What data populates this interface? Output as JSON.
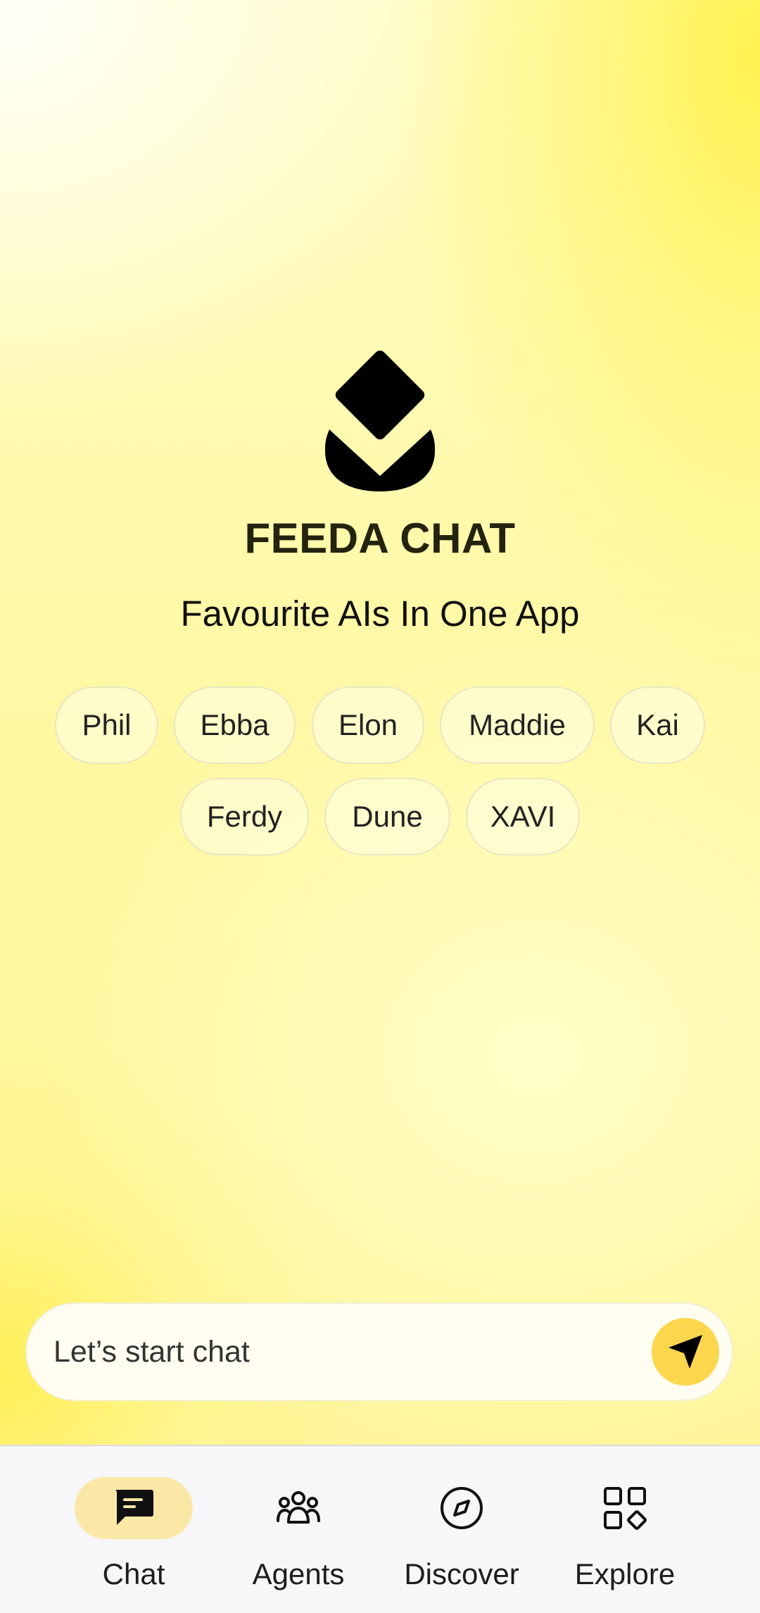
{
  "app": {
    "title": "FEEDA CHAT",
    "subtitle": "Favourite AIs In One App",
    "logo_icon": "feeda-logo-icon"
  },
  "agents": [
    "Phil",
    "Ebba",
    "Elon",
    "Maddie",
    "Kai",
    "Ferdy",
    "Dune",
    "XAVI"
  ],
  "composer": {
    "placeholder": "Let’s start chat",
    "send_icon": "send-icon"
  },
  "nav": {
    "items": [
      {
        "label": "Chat",
        "icon": "chat-bubble-icon",
        "active": true
      },
      {
        "label": "Agents",
        "icon": "group-icon",
        "active": false
      },
      {
        "label": "Discover",
        "icon": "compass-icon",
        "active": false
      },
      {
        "label": "Explore",
        "icon": "grid-apps-icon",
        "active": false
      }
    ]
  },
  "colors": {
    "accent": "#fcd64c",
    "active_nav_bg": "#fbe8a6",
    "background": "#fff9a8"
  }
}
